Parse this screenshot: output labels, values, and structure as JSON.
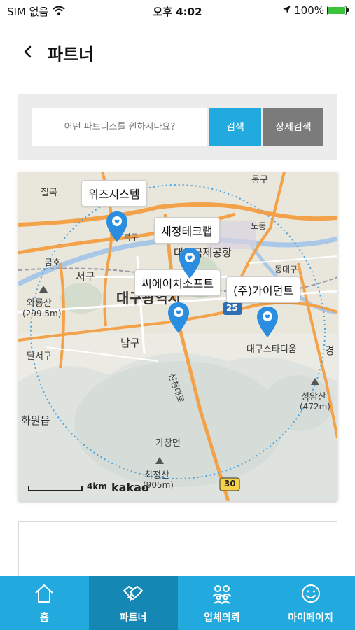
{
  "status_bar": {
    "carrier": "SIM 없음",
    "time": "오후 4:02",
    "battery": "100%",
    "battery_level": 1.0
  },
  "header": {
    "title": "파트너"
  },
  "search": {
    "placeholder": "어떤 파트너스를 원하시나요?",
    "search_label": "검색",
    "detail_label": "상세검색"
  },
  "map": {
    "place_labels": [
      "칠곡",
      "서구",
      "와룡산",
      "(299.5m)",
      "달서구",
      "남구",
      "화원읍",
      "가창면",
      "최정산",
      "(905m)",
      "동구",
      "도동",
      "동대구",
      "성암산",
      "(472m)",
      "대구스타디움",
      "대구국제공항",
      "대구광역시",
      "경",
      "신천대로",
      "25",
      "30",
      "금호",
      "북구"
    ],
    "partners": [
      "위즈시스템",
      "세정테크랩",
      "씨에이치소프트",
      "(주)가이던트"
    ],
    "scale_label": "4km",
    "logo": "kakao"
  },
  "nav": [
    {
      "label": "홈",
      "icon": "home-icon"
    },
    {
      "label": "파트너",
      "icon": "handshake-icon"
    },
    {
      "label": "업체의뢰",
      "icon": "people-icon"
    },
    {
      "label": "마이페이지",
      "icon": "smile-icon"
    }
  ],
  "colors": {
    "accent": "#22a9dd",
    "accent_active": "#1587b5",
    "detail_button": "#7b7b7b",
    "pin": "#2a8de0",
    "road": "#f3a24a"
  }
}
